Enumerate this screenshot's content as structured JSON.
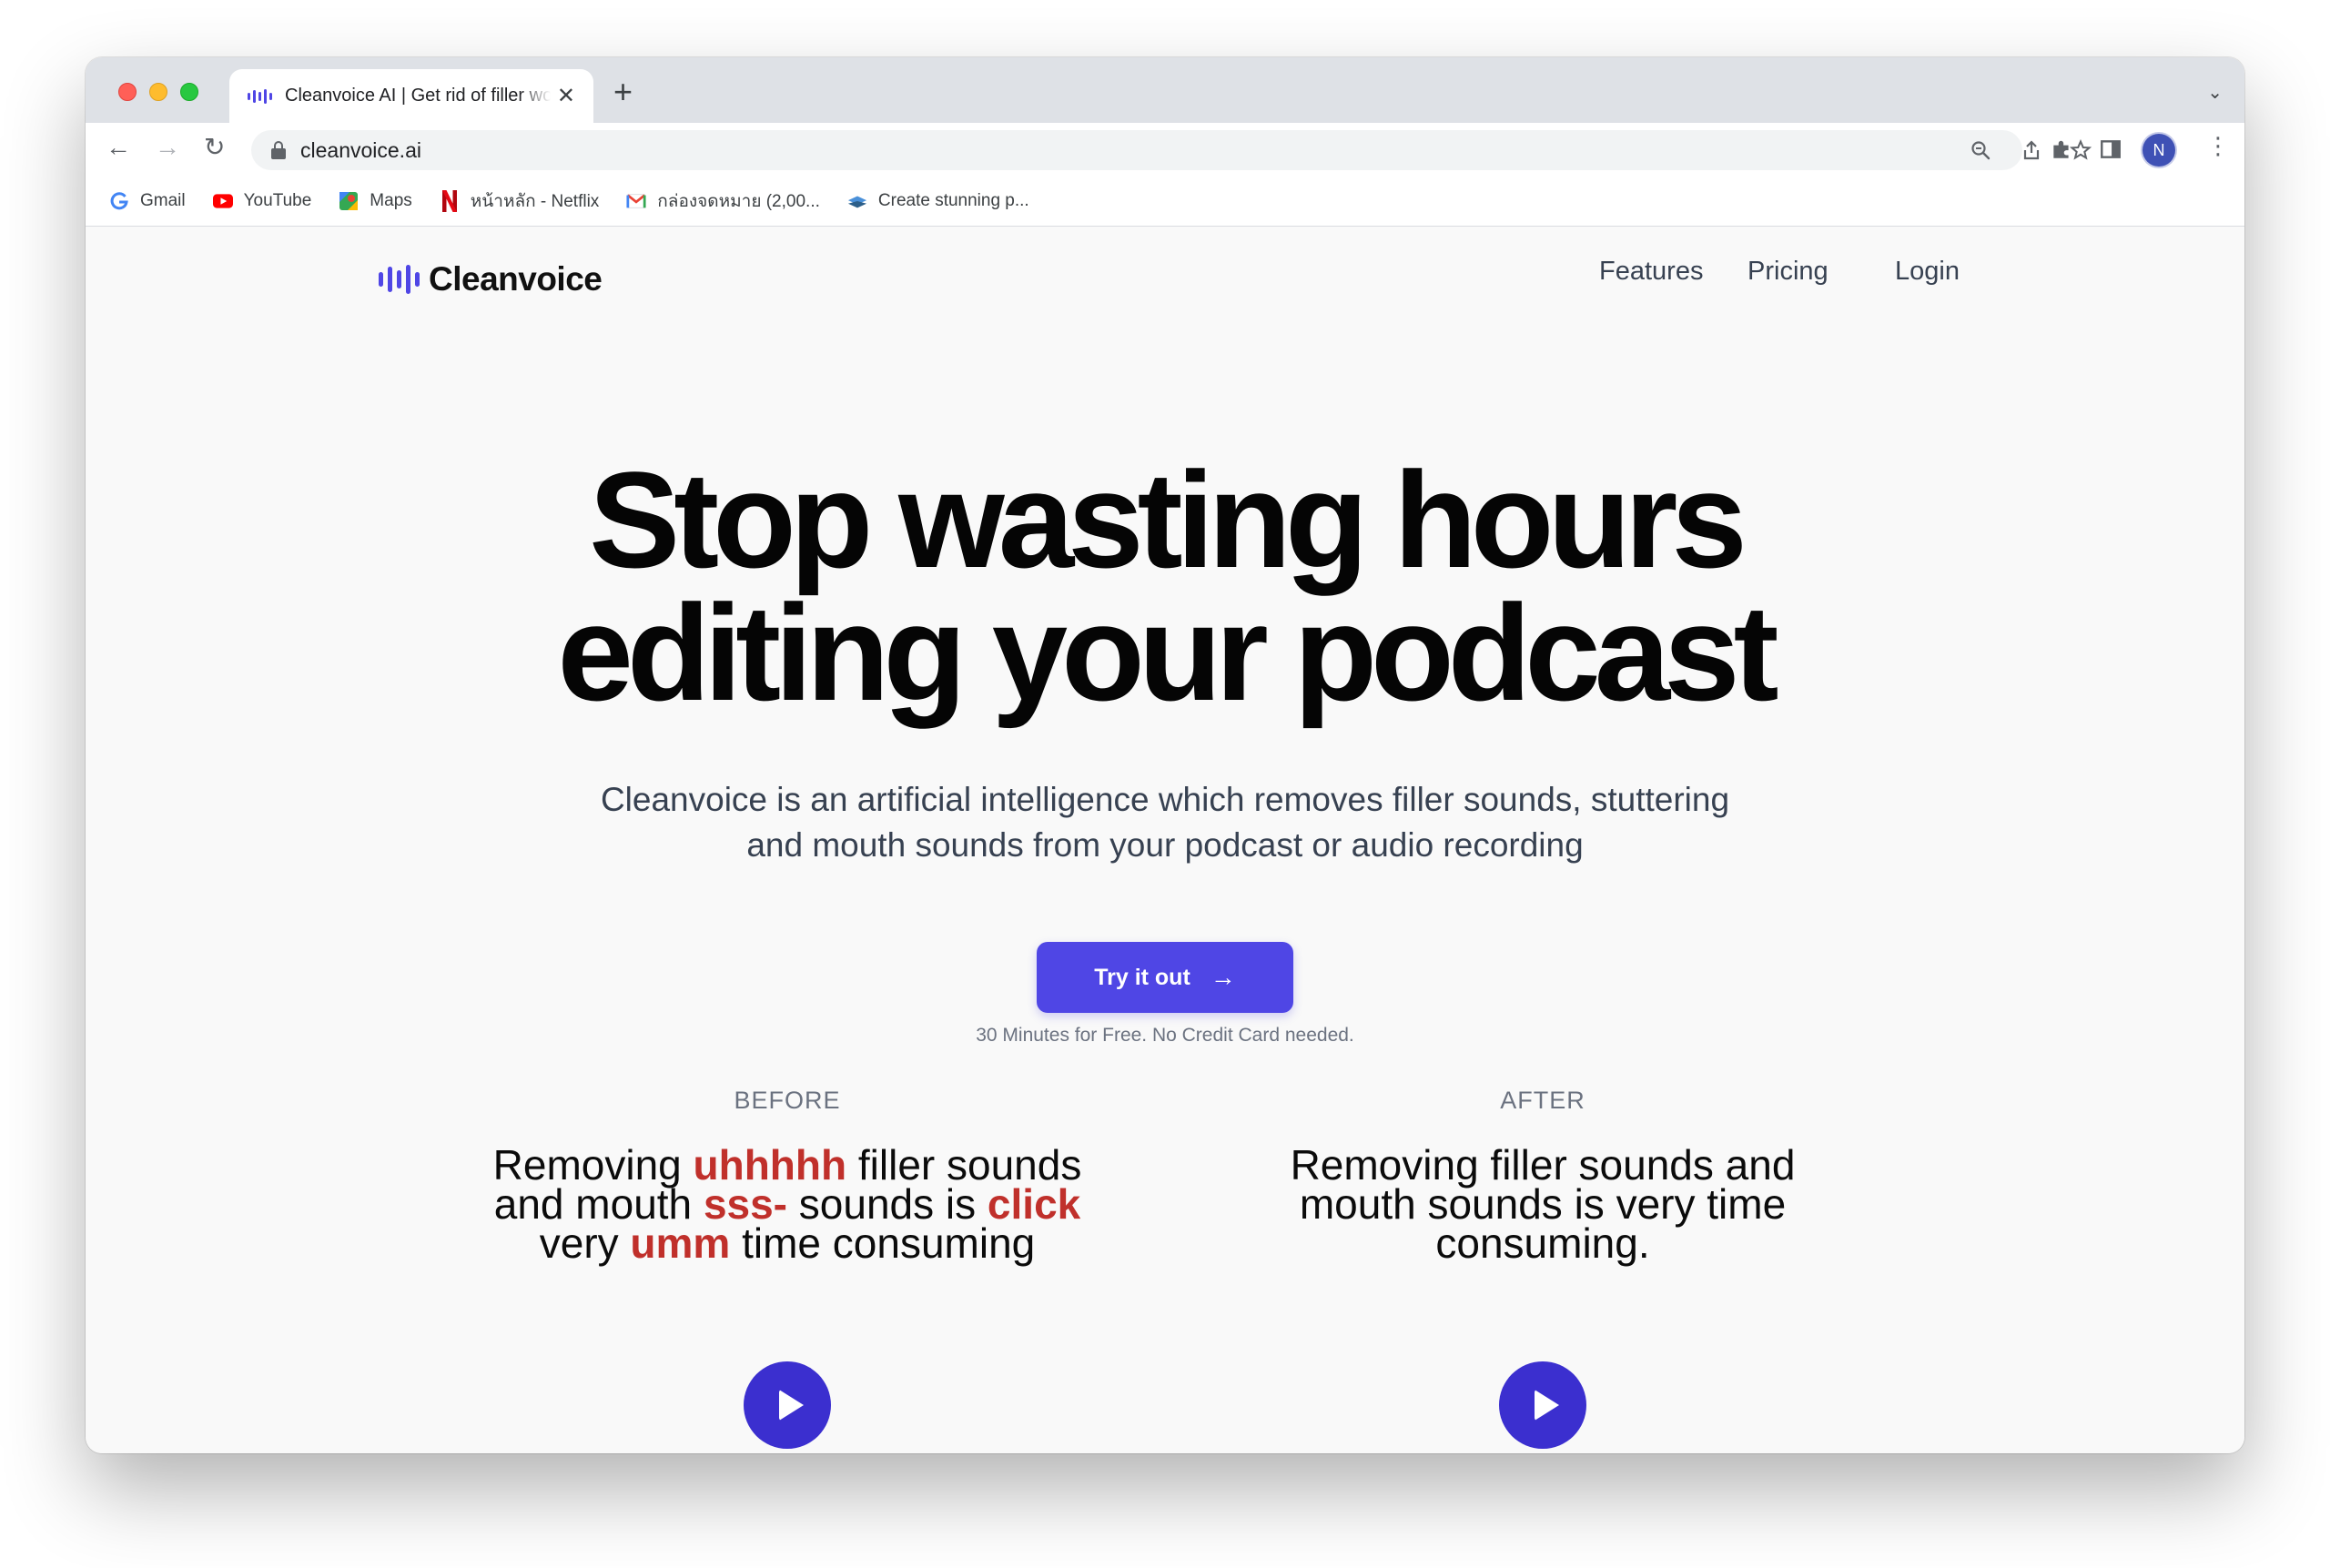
{
  "browser": {
    "tab_title": "Cleanvoice AI | Get rid of filler words",
    "tab_close": "✕",
    "new_tab": "+",
    "url": "cleanvoice.ai",
    "profile_initial": "N",
    "bookmarks": [
      {
        "label": "Gmail",
        "icon": "google-icon"
      },
      {
        "label": "YouTube",
        "icon": "youtube-icon"
      },
      {
        "label": "Maps",
        "icon": "maps-icon"
      },
      {
        "label": "หน้าหลัก - Netflix",
        "icon": "netflix-icon"
      },
      {
        "label": "กล่องจดหมาย (2,00...",
        "icon": "gmail-icon"
      },
      {
        "label": "Create stunning p...",
        "icon": "layers-icon"
      }
    ]
  },
  "site": {
    "logo": "Cleanvoice",
    "nav": {
      "features": "Features",
      "pricing": "Pricing",
      "login": "Login"
    },
    "hero_line1": "Stop wasting hours",
    "hero_line2": "editing your podcast",
    "subtitle_line1": "Cleanvoice is an artificial intelligence which removes filler sounds, stuttering",
    "subtitle_line2": "and mouth sounds from your podcast or audio recording",
    "cta_label": "Try it out",
    "cta_arrow": "→",
    "cta_note": "30 Minutes for Free. No Credit Card needed.",
    "before": {
      "label": "BEFORE",
      "t1": "Removing ",
      "f1": "uhhhhh",
      "t2": " filler sounds",
      "t3": "and mouth ",
      "f2": "sss-",
      "t4": " sounds is ",
      "f3": "click",
      "t5": "very ",
      "f4": "umm",
      "t6": " time consuming"
    },
    "after": {
      "label": "AFTER",
      "line1": "Removing filler sounds and",
      "line2": "mouth sounds is very time",
      "line3": "consuming."
    }
  },
  "colors": {
    "brand": "#4f46e5",
    "play_button": "#3b2fcf",
    "filler_word": "#c0302b"
  }
}
